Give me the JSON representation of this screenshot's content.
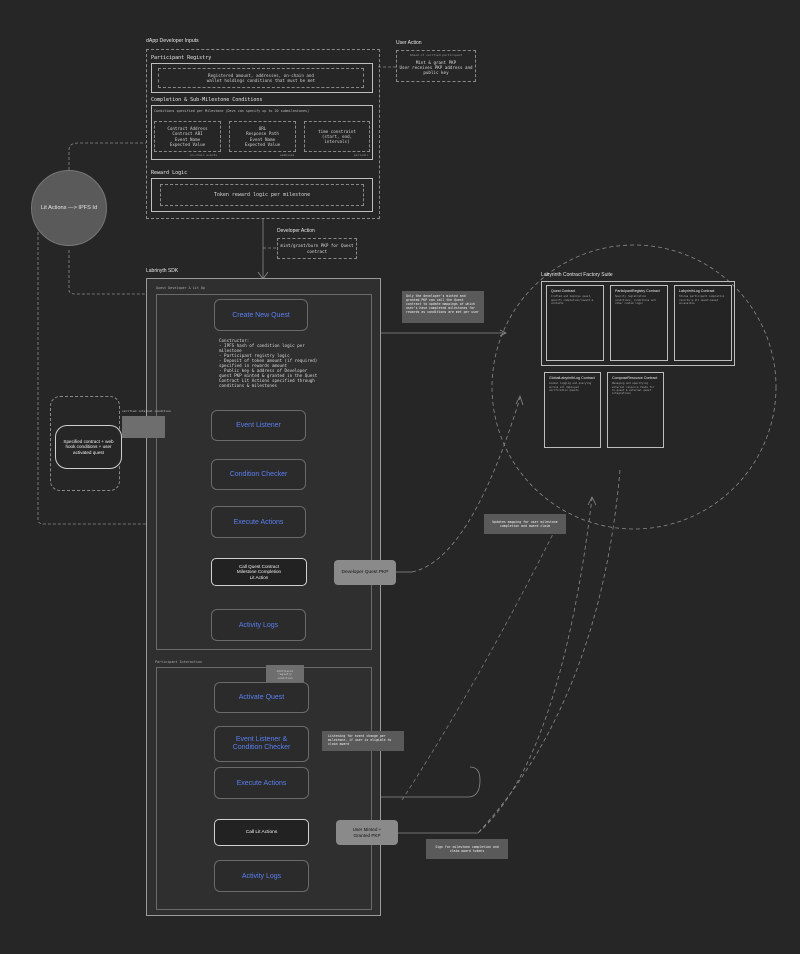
{
  "dapp": {
    "title": "dApp Developer Inputs",
    "registry_title": "Participant Registry",
    "registry_text": "Registered amount, addresses, on-chain and\nwallet holdings conditions that must be met",
    "completion_title": "Completion & Sub-Milestone Conditions",
    "completion_caption": "Conditions specified per Milestone (Devs can specify up to 20 submilestones)",
    "cond1": "Contract Address\nContract ABI\nEvent Name\nExpected Value",
    "cond1_tag": "on-chain events",
    "cond2": "URL\nResponse Path\nEvent Name\nExpected Value",
    "cond2_tag": "webhooks",
    "cond3": "time constraint\n(start, end,\nintervals)",
    "cond3_tag": "periodic",
    "reward_title": "Reward Logic",
    "reward_text": "Token reward logic per milestone"
  },
  "user_action": {
    "title": "User Action",
    "caption": "Ahead of verified participant",
    "text": "Mint & grant PKP\nUser receives PKP address and\npublic key"
  },
  "dev_action": {
    "title": "Developer Action",
    "text": "mint/grant/burn PKP for Quest\ncontract"
  },
  "lit_circle": "Lit Actions —> IPFS Id",
  "sdk": {
    "title": "Labrinyth SDK",
    "quest_dev_label": "Quest Developer & Lit Op",
    "create_quest": "Create New Quest",
    "constructor_text": "Constructor:\n- IPFS hash of condition logic per milestone\n- Participant registry logic\n- Deposit of token amount (if required) specified in rewards amount\n- Public key & address of Developer quest PKP minted & granted in the Quest Contract Lit Actions specified through conditions & milestones",
    "event_listener": "Event Listener",
    "condition_checker": "Condition Checker",
    "execute_actions": "Execute Actions",
    "call_quest": "Call Quest Contract\nMilestone Completion\nLit Action",
    "activity_logs": "Activity Logs",
    "dev_pkp": "Developer Quest PKP",
    "participant_label": "Participant Interaction",
    "act_quest": "Activate Quest",
    "event_cond": "Event Listener &\nCondition Checker",
    "execute_actions2": "Execute Actions",
    "call_lit": "Call Lit Actions",
    "activity_logs2": "Activity Logs",
    "user_pkp": "User Minted +\nGranted PKP"
  },
  "verified_label": "verified internal condition",
  "verified_box_text": "",
  "webhook_text": "Specified contract + web\nhook conditions + user\nactivated quest",
  "participant_grey_text": "Additional\nregistry\ncondition",
  "note_minted": "Only the developer's minted and granted PKP can call the Quest contract to update mappings of which user's have completed milestones for rewards as conditions are met per user",
  "note_updates": "Updates mapping for user milestone completion and award claim",
  "note_listening": "Listening for event change per milestone, if user is eligible to claim award",
  "note_sign": "Sign for milestone completion and claim award tokens",
  "factory": {
    "title": "Labyrinth Contract Factory Suite",
    "contracts": [
      {
        "name": "Quest Contract",
        "desc": "Crafted and deploys quest, specify completion/reward & contents"
      },
      {
        "name": "ParticipantRegistry Contract",
        "desc": "Specify registration conditions, conditions and other custom logic"
      },
      {
        "name": "LabyrinthLog Contract",
        "desc": "Stores participant completion records & all quest-based accessible"
      },
      {
        "name": "GlobalLabyrinthLog Contract",
        "desc": "Global logging and querying across all deployed verification quests"
      },
      {
        "name": "ComposeResource Contract",
        "desc": "Managing and specifying external resource feeds for in-quest & external quest integrations"
      }
    ]
  },
  "colors": {
    "background": "#262626",
    "accent_blue": "#5b7ff0",
    "grey_box": "#5a5a5a"
  }
}
